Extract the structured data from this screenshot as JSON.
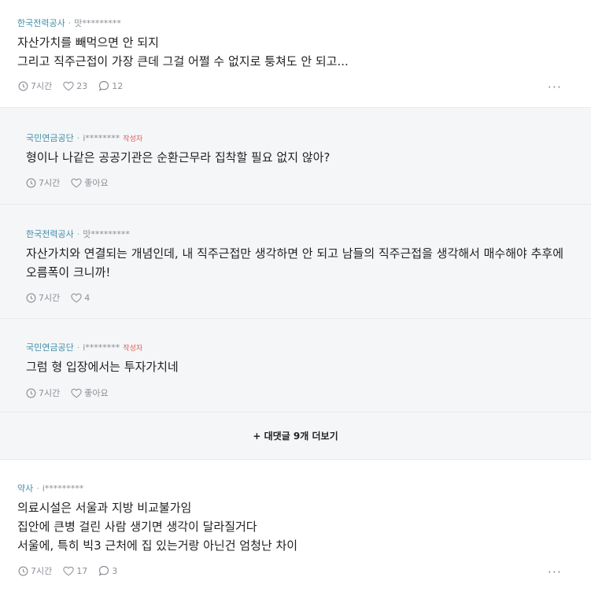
{
  "comments": [
    {
      "company": "한국전력공사",
      "user": "맛*********",
      "lines": [
        "자산가치를 빼먹으면 안 되지",
        "그리고 직주근접이 가장 큰데 그걸 어쩔 수 없지로 퉁쳐도 안 되고..."
      ],
      "time": "7시간",
      "likes": "23",
      "replies": "12"
    },
    {
      "company": "국민연금공단",
      "user": "i********",
      "author_tag": "작성자",
      "lines": [
        "형이나 나같은 공공기관은 순환근무라 집착할 필요 없지 않아?"
      ],
      "time": "7시간",
      "likes": "좋아요"
    },
    {
      "company": "한국전력공사",
      "user": "맛*********",
      "lines": [
        "자산가치와 연결되는 개념인데, 내 직주근접만 생각하면 안 되고 남들의 직주근접을 생각해서 매수해야 추후에",
        "오름폭이 크니까!"
      ],
      "time": "7시간",
      "likes": "4"
    },
    {
      "company": "국민연금공단",
      "user": "i********",
      "author_tag": "작성자",
      "lines": [
        "그럼 형 입장에서는 투자가치네"
      ],
      "time": "7시간",
      "likes": "좋아요"
    },
    {
      "company": "약사",
      "user": "i*********",
      "lines": [
        "의료시설은 서울과 지방 비교불가임",
        "집안에 큰병 걸린 사람 생기면 생각이 달라질거다",
        "서울에, 특히 빅3 근처에 집 있는거랑 아닌건 엄청난 차이"
      ],
      "time": "7시간",
      "likes": "17",
      "replies": "3"
    }
  ],
  "more_replies_label": "+ 대댓글 9개 더보기",
  "icons": {
    "time": "clock-icon",
    "like": "heart-icon",
    "reply": "speech-bubble-icon",
    "more": "more-dots-icon"
  }
}
